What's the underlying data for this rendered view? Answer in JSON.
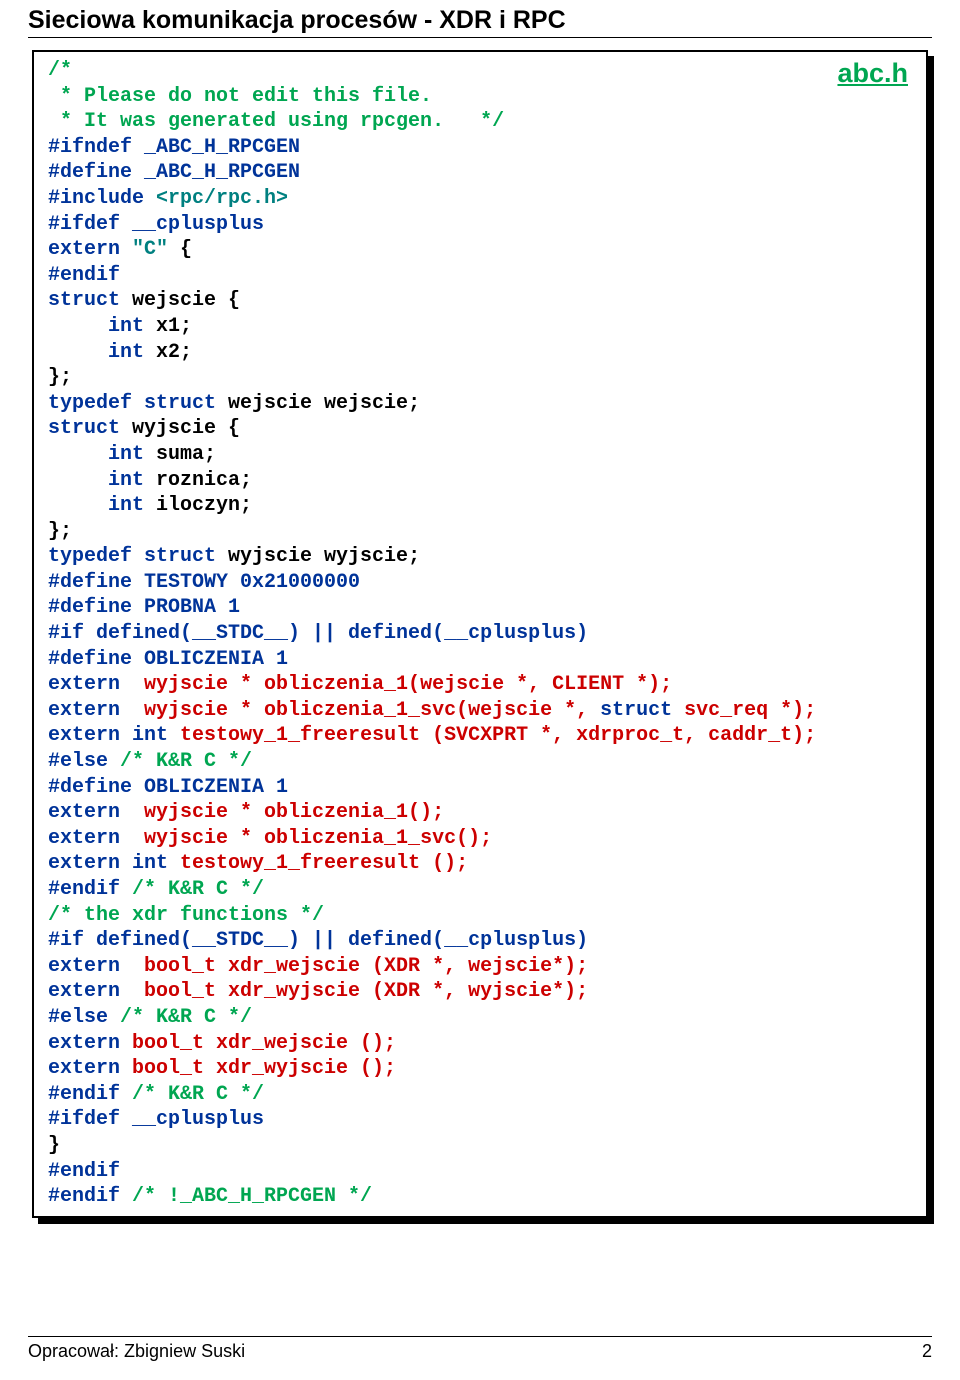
{
  "header": {
    "title": "Sieciowa komunikacja procesów - XDR i RPC"
  },
  "file": {
    "label": "abc.h"
  },
  "code": {
    "l01": "/*",
    "l02": " * Please do not edit this file.",
    "l03": " * It was generated using rpcgen.   */",
    "l04": "#ifndef _ABC_H_RPCGEN",
    "l05": "#define _ABC_H_RPCGEN",
    "l06a": "#include ",
    "l06b": "<rpc/rpc.h>",
    "l07": "#ifdef __cplusplus",
    "l08a": "extern ",
    "l08b": "\"C\"",
    "l08c": " {",
    "l09": "#endif",
    "l10a": "struct",
    "l10b": " wejscie {",
    "l11a": "     int",
    "l11b": " x1;",
    "l12a": "     int",
    "l12b": " x2;",
    "l13": "};",
    "l14a": "typedef struct",
    "l14b": " wejscie wejscie;",
    "l15a": "struct",
    "l15b": " wyjscie {",
    "l16a": "     int",
    "l16b": " suma;",
    "l17a": "     int",
    "l17b": " roznica;",
    "l18a": "     int",
    "l18b": " iloczyn;",
    "l19": "};",
    "l20a": "typedef struct",
    "l20b": " wyjscie wyjscie;",
    "l21": "#define TESTOWY 0x21000000",
    "l22": "#define PROBNA 1",
    "l23": "#if defined(__STDC__) || defined(__cplusplus)",
    "l24": "#define OBLICZENIA 1",
    "l25a": "extern ",
    "l25b": " wyjscie * obliczenia_1(wejscie *, CLIENT *);",
    "l26a": "extern ",
    "l26b": " wyjscie * obliczenia_1_svc(wejscie *, ",
    "l26c": "struct",
    "l26d": " svc_req *);",
    "l27a": "extern int",
    "l27b": " testowy_1_freeresult (SVCXPRT *, xdrproc_t, caddr_t);",
    "l28a": "#else ",
    "l28b": "/* K&R C */",
    "l29": "#define OBLICZENIA 1",
    "l30a": "extern ",
    "l30b": " wyjscie * obliczenia_1();",
    "l31a": "extern ",
    "l31b": " wyjscie * obliczenia_1_svc();",
    "l32a": "extern int",
    "l32b": " testowy_1_freeresult ();",
    "l33a": "#endif ",
    "l33b": "/* K&R C */",
    "l34": "/* the xdr functions */",
    "l35": "#if defined(__STDC__) || defined(__cplusplus)",
    "l36a": "extern ",
    "l36b": " bool_t xdr_wejscie (XDR *, wejscie*);",
    "l37a": "extern ",
    "l37b": " bool_t xdr_wyjscie (XDR *, wyjscie*);",
    "l38a": "#else ",
    "l38b": "/* K&R C */",
    "l39a": "extern",
    "l39b": " bool_t xdr_wejscie ();",
    "l40a": "extern",
    "l40b": " bool_t xdr_wyjscie ();",
    "l41a": "#endif ",
    "l41b": "/* K&R C */",
    "l42": "#ifdef __cplusplus",
    "l43": "}",
    "l44": "#endif",
    "l45a": "#endif ",
    "l45b": "/* !_ABC_H_RPCGEN */"
  },
  "footer": {
    "author": "Opracował: Zbigniew Suski",
    "page": "2"
  }
}
